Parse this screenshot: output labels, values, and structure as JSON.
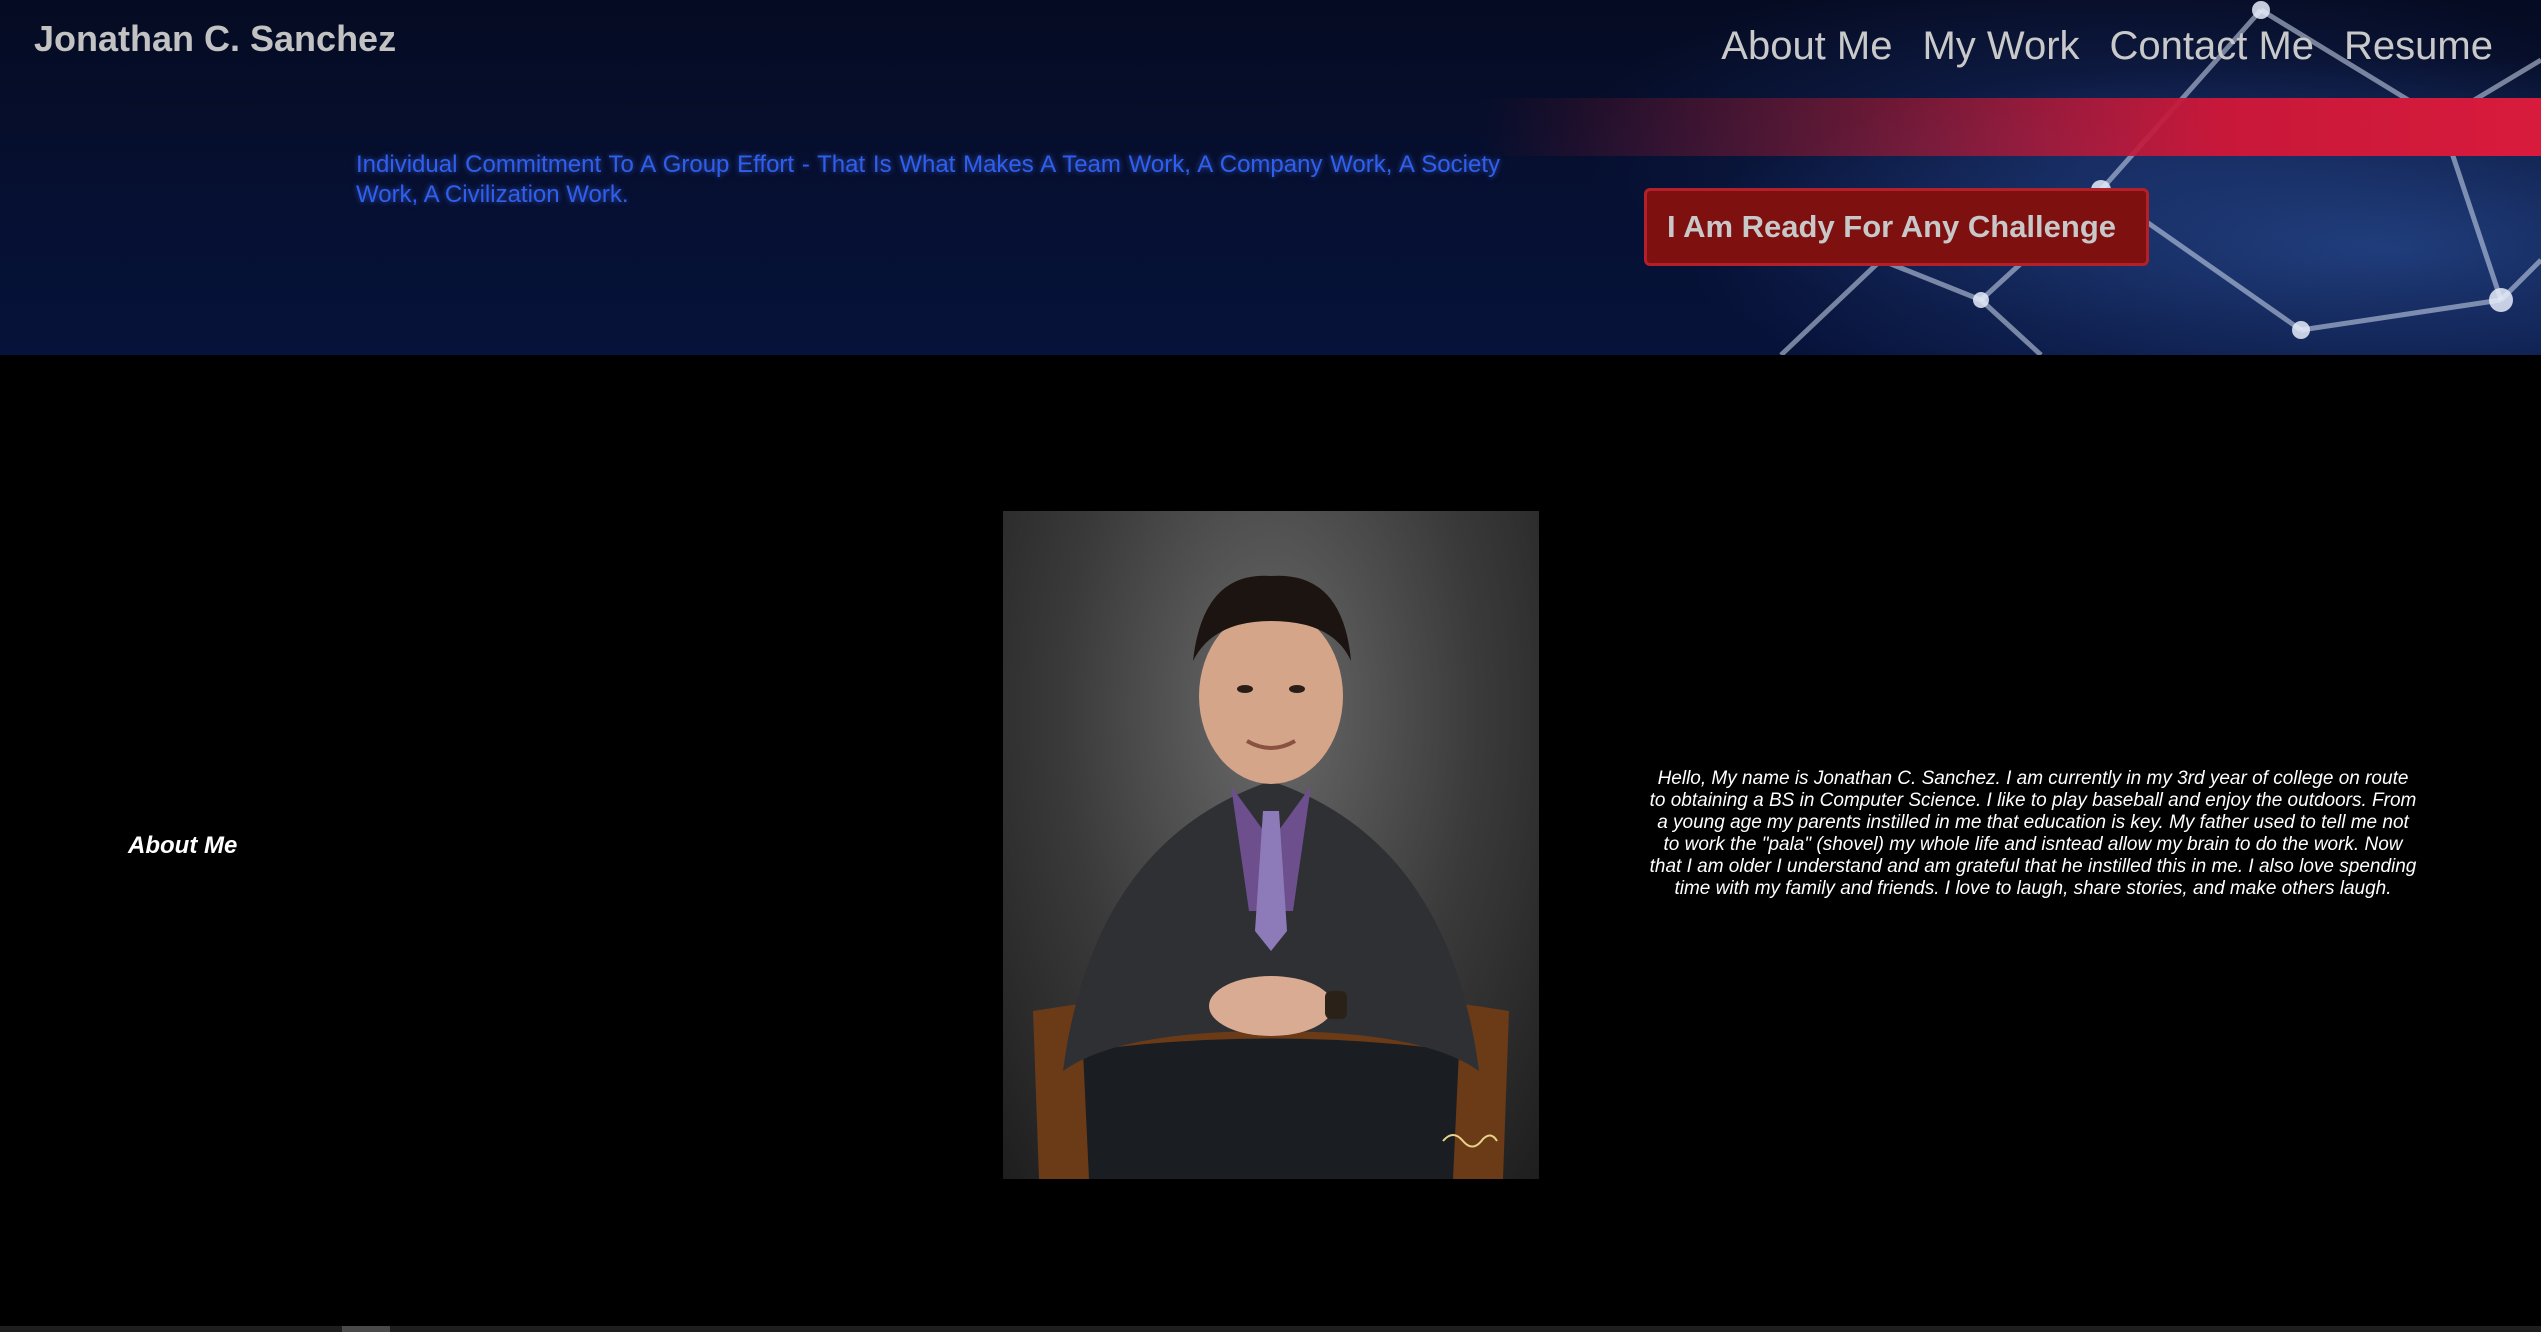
{
  "header": {
    "site_name": "Jonathan C. Sanchez",
    "nav": [
      {
        "label": "About Me"
      },
      {
        "label": "My Work"
      },
      {
        "label": "Contact Me"
      },
      {
        "label": "Resume"
      }
    ]
  },
  "hero": {
    "quote": "Individual Commitment To A Group Effort - That Is What Makes A Team Work, A Company Work, A Society Work, A Civilization Work.",
    "cta_label": "I Am Ready For Any Challenge"
  },
  "about": {
    "section_label": "About Me",
    "photo_alt": "Portrait of Jonathan C. Sanchez",
    "bio": "Hello, My name is Jonathan C. Sanchez. I am currently in my 3rd year of college on route to obtaining a BS in Computer Science. I like to play baseball and enjoy the outdoors. From a young age my parents instilled in me that education is key. My father used to tell me not to work the \"pala\" (shovel) my whole life and isntead allow my brain to do the work. Now that I am older I understand and am grateful that he instilled this in me. I also love spending time with my family and friends. I love to laugh, share stories, and make others laugh."
  },
  "colors": {
    "hero_bg": "#061033",
    "quote": "#2f5ff0",
    "cta_bg": "#7e1010",
    "accent_red": "#d81b3c",
    "nav_text": "#c9c9c9"
  }
}
